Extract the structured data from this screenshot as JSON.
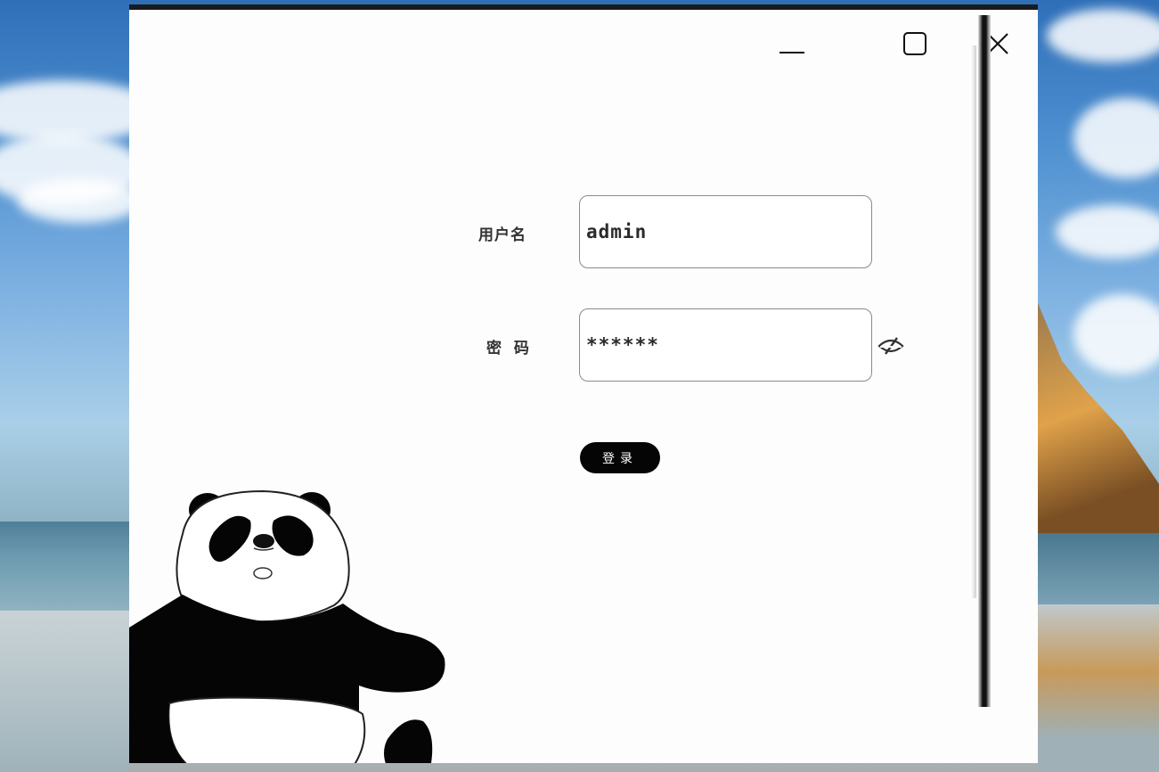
{
  "window": {
    "controls": {
      "minimize": "minimize",
      "maximize": "maximize",
      "close": "close"
    }
  },
  "form": {
    "username_label": "用户名",
    "username_value": "admin",
    "password_label": "密 码",
    "password_value": "******",
    "toggle_visibility_icon": "eye-off-icon",
    "login_label": "登录"
  },
  "colors": {
    "window_bg": "#fdfdfd",
    "button_bg": "#050505",
    "button_text": "#ffffff",
    "field_border": "#8a8a8a"
  }
}
